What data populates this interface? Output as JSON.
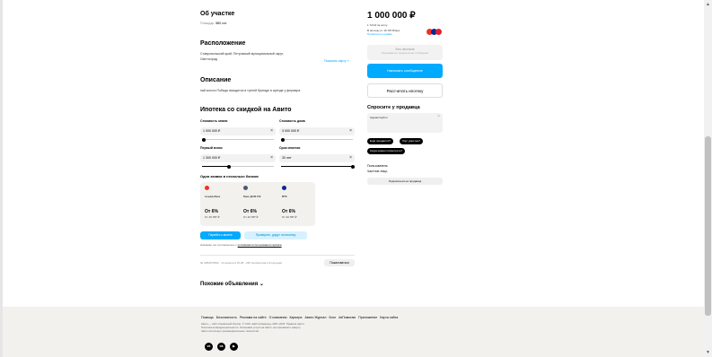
{
  "about": {
    "title": "Об участке",
    "area_label": "Площадь:",
    "area_value": "580 сот."
  },
  "location": {
    "title": "Расположение",
    "address_line1": "Ставропольский край, Петровский муниципальный округ,",
    "address_line2": "Светлоград",
    "map_link": "Показать карту"
  },
  "description": {
    "title": "Описание",
    "text": "пай колхоз Победа находится в третей бригаде в аренде у фермера"
  },
  "mortgage": {
    "title": "Ипотека со скидкой на Авито",
    "land_cost_label": "Стоимость земли",
    "land_cost_value": "1 000 000 ₽",
    "house_cost_label": "Стоимость дома",
    "house_cost_value": "3 000 000 ₽",
    "down_payment_label": "Первый взнос",
    "down_payment_value": "1 300 000 ₽",
    "term_label": "Срок ипотеки",
    "term_value": "30 лет",
    "sliders": {
      "land_cost": 0.02,
      "house_cost": 0.03,
      "down_payment": 0.37,
      "term": 1.0
    },
    "banks_title": "Одна заявка в несколько банков",
    "banks": [
      {
        "name": "Альфа-Банк",
        "rate": "От 6%",
        "payment": "От 16 787 ₽",
        "color": "#ef3124"
      },
      {
        "name": "Банк ДОМ.РФ",
        "rate": "От 6%",
        "payment": "От 16 787 ₽",
        "color": "#4a5a6e"
      },
      {
        "name": "ВТБ",
        "rate": "От 6%",
        "payment": "От 16 787 ₽",
        "color": "#0a2896"
      }
    ],
    "go_button": "Перейти к анкете",
    "check_button": "Проверить, дадут ли ипотеку",
    "consent_prefix": "Нажимая, вы соглашаетесь с",
    "consent_link": "условиями использования сервиса"
  },
  "meta": {
    "text": "№ 4054075633 · 13 апреля в 15:28 · 425 просмотров (+8 сегодня)",
    "complain_button": "Пожаловаться"
  },
  "similar": {
    "title": "Похожие объявления",
    "chevron": "⌄"
  },
  "sidebar": {
    "price": "1 000 000 ₽",
    "price_per": "1 724 ₽ за сотку",
    "mortgage_text": "В ипотеку от 16 787 ₽/мес.",
    "mortgage_link": "Посмотреть онлайн",
    "no_calls_title": "Без звонков",
    "no_calls_sub": "Пользователь предпочитает сообщения",
    "write_button": "Написать сообщение",
    "calc_button": "Рассчитать ипотеку",
    "ask_title": "Спросите у продавца",
    "ask_placeholder": "Здравствуйте!",
    "chips": [
      "Ещё продаётся?",
      "Торг уместен?",
      "Когда можно посмотреть?"
    ],
    "seller_label": "Пользователь",
    "seller_type": "Частное лицо",
    "subscribe_button": "Подписаться на продавца"
  },
  "footer": {
    "links": [
      "Помощь",
      "Безопасность",
      "Реклама на сайте",
      "О компании",
      "Карьера",
      "Авито Журнал",
      "Блог",
      "#яПомогаю",
      "Приложение",
      "Карта сайта"
    ],
    "legal1": "Авито — сайт объявлений России. © ООО «КЕХ еКоммерц» 2007–2025. Правила Авито.",
    "legal2": "Политика конфиденциальности. Оплачивая услуги на Авито, вы принимаете оферту.",
    "legal3": "Авито использует рекомендательные технологии.",
    "social": [
      "vk-icon",
      "ok-icon",
      "youtube-icon"
    ]
  },
  "colors": {
    "accent": "#00aaff",
    "field_bg": "#f2f2f2",
    "footer_bg": "#f2f1ee"
  }
}
